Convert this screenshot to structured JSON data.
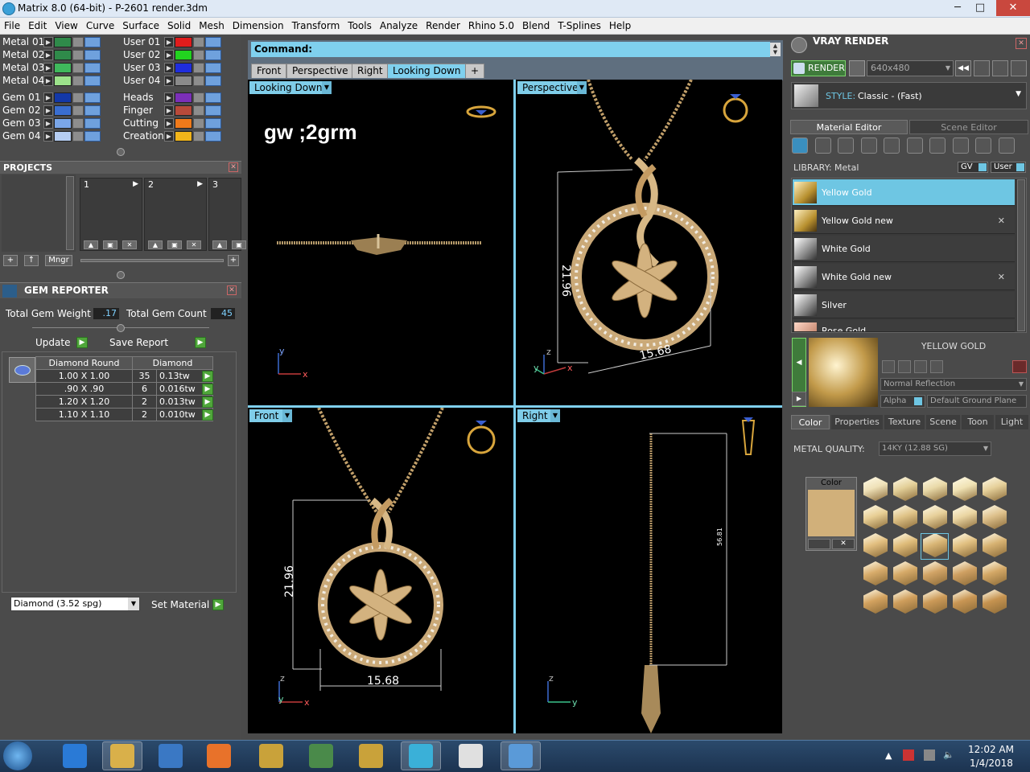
{
  "window": {
    "title": "Matrix 8.0 (64-bit) - P-2601 render.3dm",
    "minimize": "─",
    "maximize": "□",
    "close": "✕"
  },
  "menu": [
    "File",
    "Edit",
    "View",
    "Curve",
    "Surface",
    "Solid",
    "Mesh",
    "Dimension",
    "Transform",
    "Tools",
    "Analyze",
    "Render",
    "Rhino 5.0",
    "Blend",
    "T-Splines",
    "Help"
  ],
  "layers": {
    "left": [
      {
        "name": "Metal 01",
        "color": "#2f8a4a"
      },
      {
        "name": "Metal 02",
        "color": "#2f8a4a"
      },
      {
        "name": "Metal 03",
        "color": "#3fb85c"
      },
      {
        "name": "Metal 04",
        "color": "#9ce28b"
      },
      {
        "name": "Gem 01",
        "color": "#1338a8"
      },
      {
        "name": "Gem 02",
        "color": "#3a6ed0"
      },
      {
        "name": "Gem 03",
        "color": "#7aa6e8"
      },
      {
        "name": "Gem 04",
        "color": "#b5cdf2"
      }
    ],
    "right": [
      {
        "name": "User 01",
        "color": "#e01c1c"
      },
      {
        "name": "User 02",
        "color": "#22d31f"
      },
      {
        "name": "User 03",
        "color": "#1f2ddd"
      },
      {
        "name": "User 04",
        "color": "#8a8a8a"
      },
      {
        "name": "Heads",
        "color": "#7b2fb8"
      },
      {
        "name": "Finger",
        "color": "#b84a3a"
      },
      {
        "name": "Cutting",
        "color": "#f07a1a"
      },
      {
        "name": "Creation",
        "color": "#f2b51a"
      }
    ]
  },
  "projects": {
    "title": "PROJECTS",
    "slots": [
      "1",
      "2",
      "3"
    ],
    "mngr": "Mngr"
  },
  "gem_reporter": {
    "title": "GEM REPORTER",
    "weight_label": "Total Gem Weight",
    "weight_value": ".17",
    "count_label": "Total Gem Count",
    "count_value": "45",
    "update": "Update",
    "save": "Save Report",
    "table_headers": [
      "Diamond Round",
      "Diamond"
    ],
    "rows": [
      {
        "size": "1.00 X 1.00",
        "count": "35",
        "tw": "0.13tw"
      },
      {
        "size": ".90 X .90",
        "count": "6",
        "tw": "0.016tw"
      },
      {
        "size": "1.20 X 1.20",
        "count": "2",
        "tw": "0.013tw"
      },
      {
        "size": "1.10 X 1.10",
        "count": "2",
        "tw": "0.010tw"
      }
    ],
    "material_select": "Diamond    (3.52 spg)",
    "set_material": "Set Material"
  },
  "command": {
    "label": "Command:"
  },
  "view_tabs": [
    "Front",
    "Perspective",
    "Right",
    "Looking Down",
    "+"
  ],
  "viewports": {
    "top_left": {
      "label": "Looking Down",
      "note": "gw ;2grm"
    },
    "top_right": {
      "label": "Perspective",
      "dim_v": "21.96",
      "dim_h": "15.68"
    },
    "bottom_left": {
      "label": "Front",
      "dim_v": "21.96",
      "dim_h": "15.68"
    },
    "bottom_right": {
      "label": "Right",
      "dim_v": "56.81"
    }
  },
  "vray": {
    "title": "VRAY RENDER",
    "render_btn": "RENDER",
    "resolution": "640x480",
    "style_label": "STYLE:",
    "style_value": "Classic - (Fast)",
    "tabs": [
      "Material Editor",
      "Scene Editor"
    ],
    "library_label": "LIBRARY: Metal",
    "gv": "GV",
    "user": "User",
    "materials": [
      {
        "name": "Yellow Gold",
        "removable": false,
        "selected": true
      },
      {
        "name": "Yellow Gold new",
        "removable": true,
        "selected": false
      },
      {
        "name": "White Gold",
        "removable": false,
        "selected": false
      },
      {
        "name": "White Gold new",
        "removable": true,
        "selected": false
      },
      {
        "name": "Silver",
        "removable": false,
        "selected": false
      },
      {
        "name": "Rose Gold",
        "removable": false,
        "selected": false
      }
    ],
    "preview_title": "YELLOW GOLD",
    "reflection": "Normal Reflection",
    "alpha": "Alpha",
    "ground": "Default Ground Plane",
    "prop_tabs": [
      "Color",
      "Properties",
      "Texture",
      "Scene",
      "Toon",
      "Light"
    ],
    "metal_quality_label": "METAL QUALITY:",
    "metal_quality_value": "14KY          (12.88 SG)",
    "color_label": "Color",
    "gold_color": "#d1b07a",
    "accent": "#7fd0ee"
  },
  "taskbar": {
    "time": "12:02 AM",
    "date": "1/4/2018"
  }
}
